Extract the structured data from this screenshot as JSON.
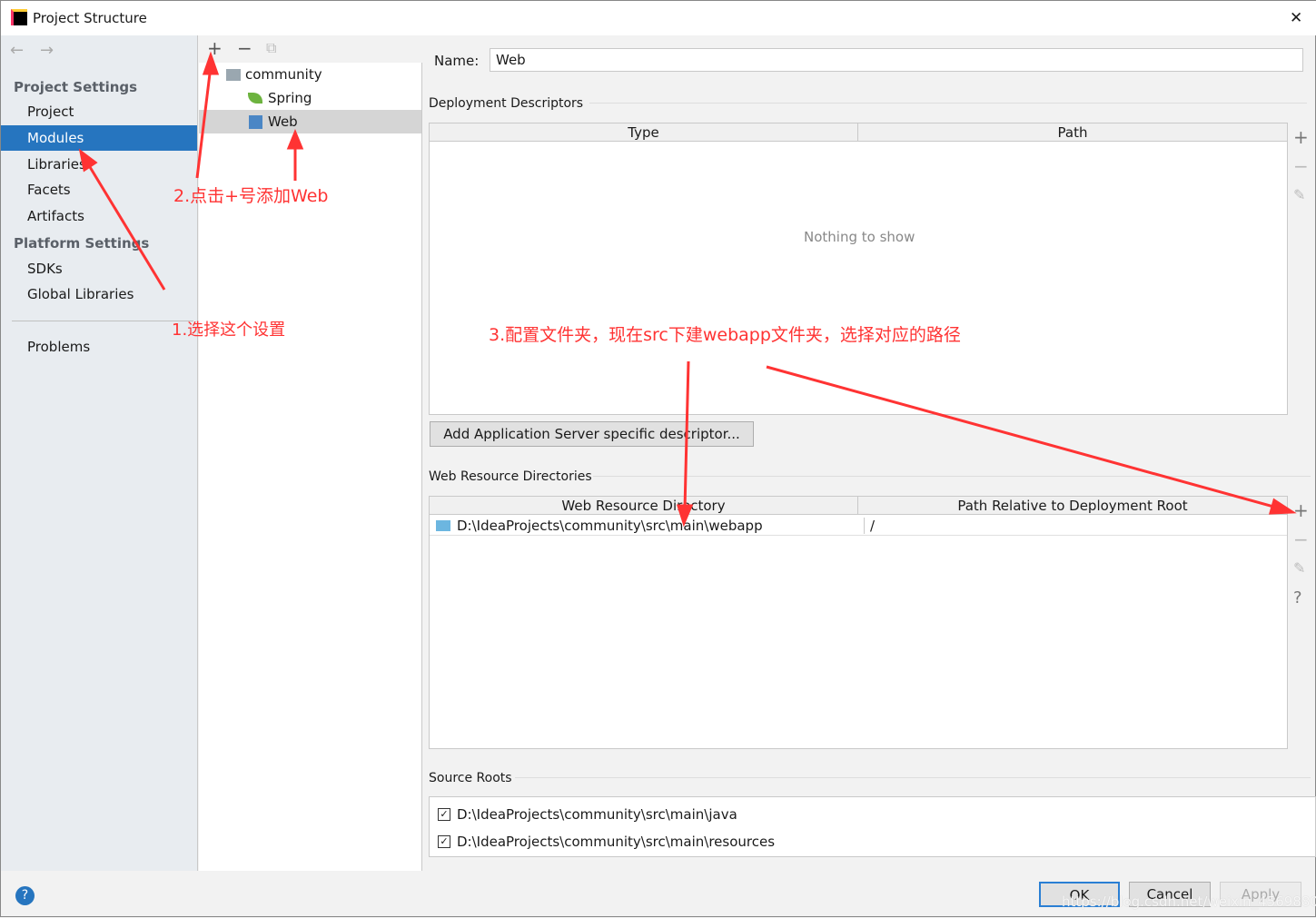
{
  "window": {
    "title": "Project Structure",
    "close": "✕"
  },
  "sidebar": {
    "back": "←",
    "forward": "→",
    "project_settings": "Project Settings",
    "items": [
      "Project",
      "Modules",
      "Libraries",
      "Facets",
      "Artifacts"
    ],
    "platform_settings": "Platform Settings",
    "platform_items": [
      "SDKs",
      "Global Libraries"
    ],
    "problems": "Problems"
  },
  "tree": {
    "add": "+",
    "remove": "−",
    "copy": "⧉",
    "nodes": [
      "community",
      "Spring",
      "Web"
    ]
  },
  "main": {
    "name_label": "Name:",
    "name_value": "Web",
    "deployment": {
      "title": "Deployment Descriptors",
      "columns": [
        "Type",
        "Path"
      ],
      "empty": "Nothing to show",
      "add_button": "Add Application Server specific descriptor..."
    },
    "web_resources": {
      "title": "Web Resource Directories",
      "columns": [
        "Web Resource Directory",
        "Path Relative to Deployment Root"
      ],
      "rows": [
        [
          "D:\\IdeaProjects\\community\\src\\main\\webapp",
          "/"
        ]
      ]
    },
    "source_roots": {
      "title": "Source Roots",
      "items": [
        "D:\\IdeaProjects\\community\\src\\main\\java",
        "D:\\IdeaProjects\\community\\src\\main\\resources"
      ]
    }
  },
  "side_tools": {
    "add": "+",
    "remove": "−",
    "edit": "✎",
    "help": "?"
  },
  "footer": {
    "help": "?",
    "ok": "OK",
    "cancel": "Cancel",
    "apply": "Apply"
  },
  "annotations": {
    "a1": "1.选择这个设置",
    "a2": "2.点击+号添加Web",
    "a3": "3.配置文件夹，现在src下建webapp文件夹，选择对应的路径"
  },
  "watermark": "https://blog.csdn.net/weixin_45698805"
}
